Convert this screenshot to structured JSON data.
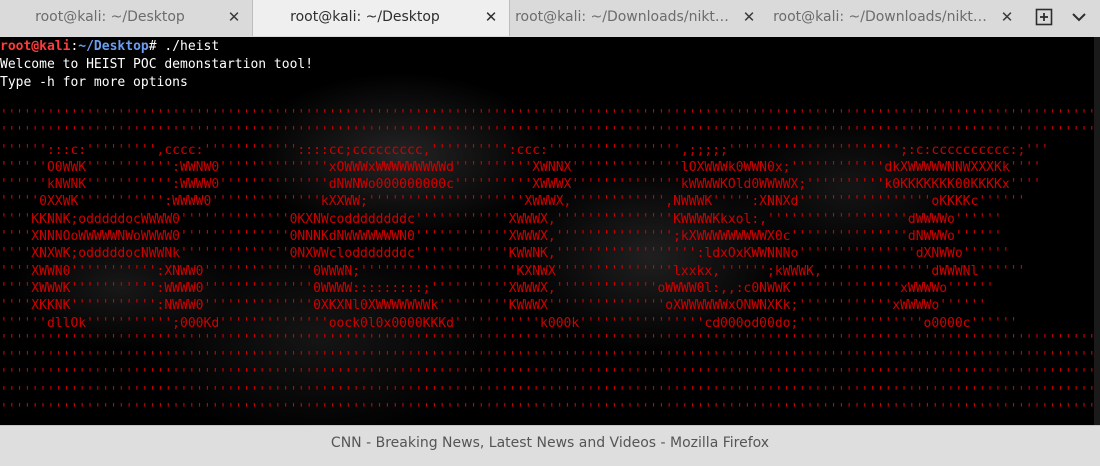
{
  "tabs": [
    {
      "label": "root@kali: ~/Desktop",
      "active": false
    },
    {
      "label": "root@kali: ~/Desktop",
      "active": true
    },
    {
      "label": "root@kali: ~/Downloads/nikt…",
      "active": false
    },
    {
      "label": "root@kali: ~/Downloads/nikt…",
      "active": false
    }
  ],
  "tab_close_glyph": "✕",
  "icons": {
    "new_tab": "new-tab-icon",
    "menu": "hamburger-menu-icon"
  },
  "terminal": {
    "prompt_user": "root@kali",
    "prompt_sep": ":",
    "prompt_path": "~/Desktop",
    "prompt_symbol": "# ",
    "command": "./heist",
    "output": [
      "Welcome to HEIST POC demonstartion tool!",
      "Type -h for more options"
    ],
    "banner": [
      "''''''''''''''''''''''''''''''''''''''''''''''''''''''''''''''''''''''''''''''''''''''''''''''''''''''''''''''''''''''''''''''''''''''''''''''''''''''''''''''''''''''''''''''''''''''''''''",
      "''''''''''''''''''''''''''''''''''''''''''''''''''''''''''''''''''''''''''''''''''''''''''''''''''''''''''''''''''''''''''''''''''''''''''''''''''''''''''''''''''''''''''''''''''''''''''",
      "'''''':::c:''''''''',cccc:''''''''''''::::cc;ccccccccc,'''''''''':ccc:''''''''''''''''',;;;;;'''''''''''''''''''''';:c:cccccccccc:;'''",
      "''''''O0WWK''''''''''':WWNW0''''''''''''''xOWWWxWWWWWWWWWd''''''''''XWNNX''''''''''''''lOXWWWk0WWN0x;''''''''''''dkXWWWWWNNWXXXKk''''",
      "''''''kNWNK''''''''''':WWWW0''''''''''''''dNWNWo000000000c''''''''''XWWWX''''''''''''''kWWWWKOld0WWWWX;''''''''''k0KKKKKKK00KKKKx''''",
      "'''''0XXWK''''''''''':WWWW0''''''''''''''kXXWW;''''''''''''''''''''XWWWX,'''''''''''',NWWWK''''':XNNXd'''''''''''''''''oKKKKc''''''",
      "''''KKNNK;odddddocWWWW0''''''''''''''0KXNWcoddddddddc''''''''''''XWWWX,'''''''''''''''KWWWWKkxol:,''''''''''''''''''dWWWWo''''''",
      "''''XNNNOoWWWWWNWoWWWW0''''''''''''''0NNNKdNWWWWWWWN0''''''''''''XWWWX,''''''''''''''';kXWWWWWWWWWX0c'''''''''''''''dNWWWo''''''",
      "''''XNXWK;odddddocNWWNk''''''''''''''0NXWWclodddddddc''''''''''''KWWNK,'''''''''''''''''':ldxOxKWWNNNo'''''''''''''''dXNWWo''''''",
      "''''XWWN0''''''''''':XNWW0''''''''''''''0WWWN;''''''''''''''''''''KXNWX'''''''''''''''lxxkx,'''''';kWWWK,''''''''''''''dWWWNl''''''",
      "''''XWWWK''''''''''':WWWW0''''''''''''''0WWWW:::::::::;''''''''''XWWWX,'''''''''''''oWWWW0l:,,:c0NWWK''''''''''''''xWWWWo''''''",
      "''''XKKNK''''''''''':NWWW0''''''''''''''0XKXNl0XWWWWWWWk'''''''''KWWWX'''''''''''''''oXWWWWWWxONWNXKk;''''''''''''xWWWWo''''''",
      "''''''dllOk''''''''''';000Kd''''''''''''''oock0l0x0000KKKd'''''''''''k000k''''''''''''''''cd000od00do;''''''''''''''''o0000c''''''",
      "''''''''''''''''''''''''''''''''''''''''''''''''''''''''''''''''''''''''''''''''''''''''''''''''''''''''''''''''''''''''''''''''''''''''''''''''''''''''''''''''''''''''''''''''''''''''",
      "''''''''''''''''''''''''''''''''''''''''''''''''''''''''''''''''''''''''''''''''''''''''''''''''''''''''''''''''''''''''''''''''''''''''''''''''''''''''''''''''''''''''''''''''''''''''",
      "''''''''''''''''''''''''''''''''''''''''''''''''''''''''''''''''''''''''''''''''''''''''''''''''''''''''''''''''''''''''''''''''''''''''''''''''''''''''''''''''''''''''''''''''''''''''",
      "''''''''''''''''''''''''''''''''''''''''''''''''''''''''''''''''''''''''''''''''''''''''''''''''''''''''''''''''''''''''''''''''''''''''''''''''''''''''''''''''''''''''''''''''''''''''",
      "''''''''''''''''''''''''''''''''''''''''''''''''''''''''''''''''''''''''''''''''''''''''''''''''''''''''''''''''''''''''''''''''''''''''''''''''''''''''''''''''''''''''''''''''''''''''"
    ]
  },
  "status_bar": {
    "title": "CNN - Breaking News, Latest News and Videos - Mozilla Firefox"
  }
}
